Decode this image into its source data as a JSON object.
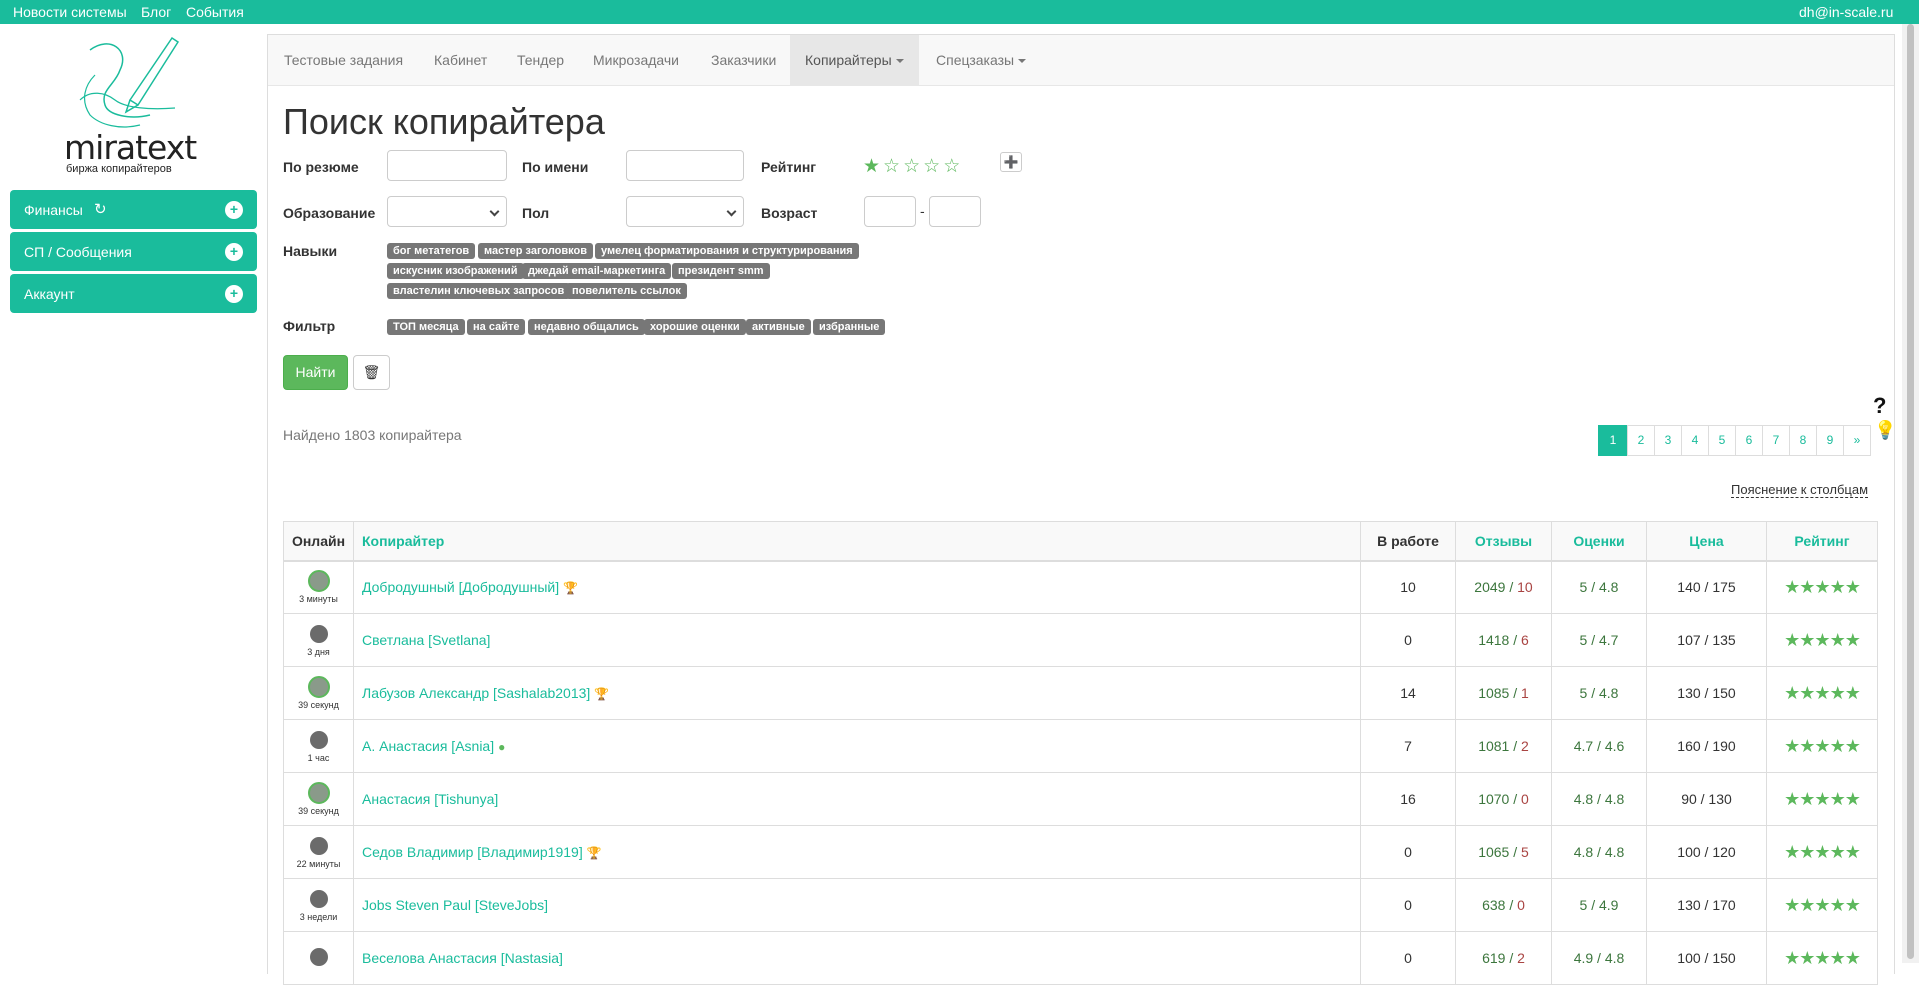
{
  "topbar": {
    "links": [
      "Новости системы",
      "Блог",
      "События"
    ],
    "user_email": "dh@in-scale.ru",
    "color": "#1abc9c"
  },
  "logo": {
    "text": "miratext",
    "subtitle": "биржа копирайтеров"
  },
  "sidebar": {
    "items": [
      {
        "label": "Финансы",
        "icon": "refresh-icon"
      },
      {
        "label": "СП / Сообщения"
      },
      {
        "label": "Аккаунт"
      }
    ]
  },
  "nav": {
    "items": [
      "Тестовые задания",
      "Кабинет",
      "Тендер",
      "Микрозадачи",
      "Заказчики",
      "Копирайтеры",
      "Спецзаказы"
    ],
    "active": "Копирайтеры"
  },
  "page": {
    "title": "Поиск копирайтера"
  },
  "filters": {
    "resume_label": "По резюме",
    "name_label": "По имени",
    "rating_label": "Рейтинг",
    "rating_value": 1,
    "education_label": "Образование",
    "gender_label": "Пол",
    "age_label": "Возраст",
    "age_dash": "-",
    "skills_label": "Навыки",
    "skills": [
      "бог метатегов",
      "мастер заголовков",
      "умелец форматирования и структурирования",
      "искусник изображений",
      "джедай email-маркетинга",
      "президент smm",
      "властелин ключевых запросов",
      "повелитель ссылок"
    ],
    "filter_label": "Фильтр",
    "filter_tags": [
      "ТОП месяца",
      "на сайте",
      "недавно общались",
      "хорошие оценки",
      "активные",
      "избранные"
    ],
    "find_button": "Найти"
  },
  "results": {
    "found_text": "Найдено 1803 копирайтера",
    "pages": [
      "1",
      "2",
      "3",
      "4",
      "5",
      "6",
      "7",
      "8",
      "9",
      "»"
    ],
    "current_page": "1",
    "explain_link": "Пояснение к столбцам",
    "help_mark": "?"
  },
  "table": {
    "headers": [
      "Онлайн",
      "Копирайтер",
      "В работе",
      "Отзывы",
      "Оценки",
      "Цена",
      "Рейтинг"
    ],
    "rows": [
      {
        "ago": "3 минуты",
        "online": true,
        "name": "Добродушный [Добродушный]",
        "badge": "trophy",
        "work": "10",
        "rev_good": "2049",
        "rev_bad": "10",
        "scores": "5 / 4.8",
        "price": "140 / 175",
        "stars": 5
      },
      {
        "ago": "3 дня",
        "online": false,
        "name": "Светлана [Svetlana]",
        "badge": "",
        "work": "0",
        "rev_good": "1418",
        "rev_bad": "6",
        "scores": "5 / 4.7",
        "price": "107 / 135",
        "stars": 5
      },
      {
        "ago": "39 секунд",
        "online": true,
        "name": "Лабузов Александр [Sashalab2013]",
        "badge": "trophy",
        "work": "14",
        "rev_good": "1085",
        "rev_bad": "1",
        "scores": "5 / 4.8",
        "price": "130 / 150",
        "stars": 5
      },
      {
        "ago": "1 час",
        "online": false,
        "name": "А. Анастасия [Asnia]",
        "badge": "clock",
        "work": "7",
        "rev_good": "1081",
        "rev_bad": "2",
        "scores": "4.7 / 4.6",
        "price": "160 / 190",
        "stars": 5
      },
      {
        "ago": "39 секунд",
        "online": true,
        "name": "Анастасия [Tishunya]",
        "badge": "",
        "work": "16",
        "rev_good": "1070",
        "rev_bad": "0",
        "scores": "4.8 / 4.8",
        "price": "90 / 130",
        "stars": 5
      },
      {
        "ago": "22 минуты",
        "online": false,
        "name": "Седов Владимир [Владимир1919]",
        "badge": "trophy",
        "work": "0",
        "rev_good": "1065",
        "rev_bad": "5",
        "scores": "4.8 / 4.8",
        "price": "100 / 120",
        "stars": 5
      },
      {
        "ago": "3 недели",
        "online": false,
        "name": "Jobs Steven Paul [SteveJobs]",
        "badge": "",
        "work": "0",
        "rev_good": "638",
        "rev_bad": "0",
        "scores": "5 / 4.9",
        "price": "130 / 170",
        "stars": 5
      },
      {
        "ago": "",
        "online": false,
        "name": "Веселова Анастасия [Nastasia]",
        "badge": "",
        "work": "0",
        "rev_good": "619",
        "rev_bad": "2",
        "scores": "4.9 / 4.8",
        "price": "100 / 150",
        "stars": 5
      }
    ]
  }
}
